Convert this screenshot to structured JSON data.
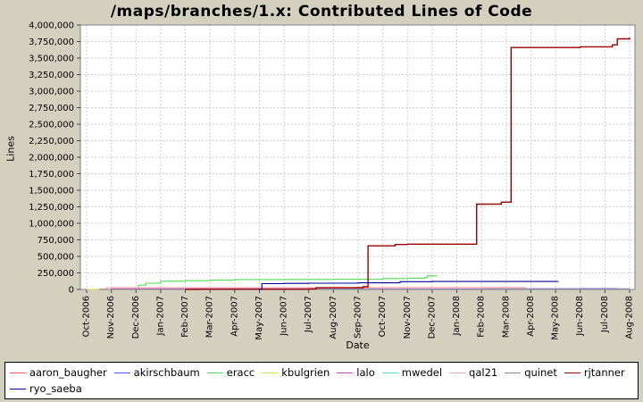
{
  "colors": {
    "page_background": "#d4d0c0",
    "plot_background": "#ffffff",
    "grid_color": "#cccccc",
    "plot_border_color": "#808080"
  },
  "chart_data": {
    "type": "line",
    "line_style": "step-after",
    "title": "/maps/branches/1.x: Contributed Lines of Code",
    "xlabel": "Date",
    "ylabel": "Lines",
    "ylim": [
      0,
      4000000
    ],
    "y_tick_step": 250000,
    "y_tick_labels": [
      "0",
      "250,000",
      "500,000",
      "750,000",
      "1,000,000",
      "1,250,000",
      "1,500,000",
      "1,750,000",
      "2,000,000",
      "2,250,000",
      "2,500,000",
      "2,750,000",
      "3,000,000",
      "3,250,000",
      "3,500,000",
      "3,750,000",
      "4,000,000"
    ],
    "x_tick_labels": [
      "Oct-2006",
      "Nov-2006",
      "Dec-2006",
      "Jan-2007",
      "Feb-2007",
      "Mar-2007",
      "Apr-2007",
      "May-2007",
      "Jun-2007",
      "Jul-2007",
      "Aug-2007",
      "Sep-2007",
      "Oct-2007",
      "Nov-2007",
      "Dec-2007",
      "Jan-2008",
      "Feb-2008",
      "Mar-2008",
      "Apr-2008",
      "May-2008",
      "Jun-2008",
      "Jul-2008",
      "Aug-2008"
    ],
    "x_unit": "months since Oct-2006 (fractional = intra-month step)",
    "grid": true,
    "legend_position": "bottom",
    "series": [
      {
        "name": "aaron_baugher",
        "color": "#ff5555",
        "points": [
          [
            0.5,
            500
          ],
          [
            22,
            500
          ]
        ]
      },
      {
        "name": "akirschbaum",
        "color": "#5555ff",
        "points": [
          [
            12.2,
            4000
          ],
          [
            13,
            5000
          ],
          [
            14,
            6000
          ],
          [
            16,
            8000
          ],
          [
            18,
            10000
          ],
          [
            20,
            12000
          ],
          [
            21.5,
            13000
          ]
        ]
      },
      {
        "name": "eracc",
        "color": "#55dd55",
        "points": [
          [
            1,
            3000
          ],
          [
            2.1,
            65000
          ],
          [
            2.4,
            95000
          ],
          [
            3,
            125000
          ],
          [
            4,
            132000
          ],
          [
            5,
            141000
          ],
          [
            6,
            150000
          ],
          [
            8,
            152000
          ],
          [
            10,
            155000
          ],
          [
            12,
            165000
          ],
          [
            13,
            170000
          ],
          [
            13.7,
            178000
          ],
          [
            13.8,
            205000
          ],
          [
            14.2,
            207000
          ]
        ]
      },
      {
        "name": "kbulgrien",
        "color": "#dddd55",
        "points": [
          [
            0,
            2000
          ],
          [
            10,
            2500
          ],
          [
            22,
            3000
          ]
        ]
      },
      {
        "name": "lalo",
        "color": "#cc44cc",
        "points": [
          [
            1,
            9000
          ],
          [
            22,
            10000
          ]
        ]
      },
      {
        "name": "mwedel",
        "color": "#55dddd",
        "points": [
          [
            7,
            2500
          ],
          [
            22,
            3000
          ]
        ]
      },
      {
        "name": "qal21",
        "color": "#ffaaaa",
        "points": [
          [
            0.6,
            5000
          ],
          [
            0.8,
            28000
          ],
          [
            6,
            29000
          ],
          [
            12,
            30000
          ],
          [
            17.8,
            30000
          ]
        ]
      },
      {
        "name": "quinet",
        "color": "#888888",
        "points": [
          [
            0.5,
            800
          ],
          [
            22,
            800
          ]
        ]
      },
      {
        "name": "rjtanner",
        "color": "#990000",
        "points": [
          [
            4,
            2000
          ],
          [
            4.6,
            4000
          ],
          [
            9,
            8000
          ],
          [
            9.3,
            25000
          ],
          [
            10.9,
            27000
          ],
          [
            11.2,
            40000
          ],
          [
            11.4,
            660000
          ],
          [
            12.5,
            680000
          ],
          [
            13,
            685000
          ],
          [
            15.7,
            685000
          ],
          [
            15.8,
            1290000
          ],
          [
            16.8,
            1320000
          ],
          [
            17.2,
            3660000
          ],
          [
            20,
            3670000
          ],
          [
            21.3,
            3700000
          ],
          [
            21.5,
            3790000
          ],
          [
            22,
            3810000
          ]
        ]
      },
      {
        "name": "ryo_saeba",
        "color": "#000099",
        "points": [
          [
            7,
            2000
          ],
          [
            7.1,
            88000
          ],
          [
            8,
            92000
          ],
          [
            9,
            95000
          ],
          [
            11,
            100000
          ],
          [
            12.7,
            118000
          ],
          [
            14,
            120000
          ],
          [
            19.1,
            122000
          ]
        ]
      }
    ]
  }
}
